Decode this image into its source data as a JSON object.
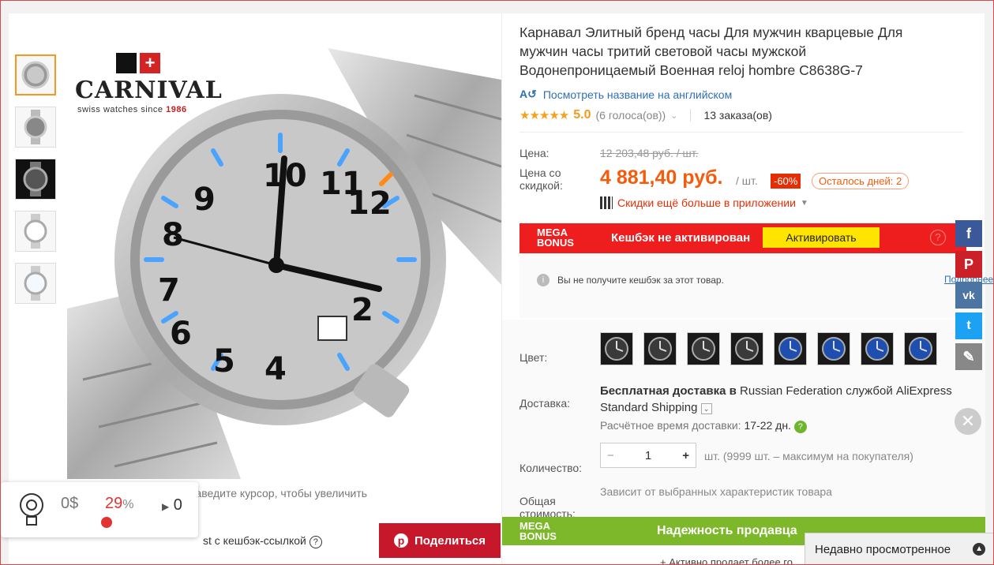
{
  "logo": {
    "brand": "CARNIVAL",
    "tagline": "swiss watches since",
    "year": "1986"
  },
  "gallery": {
    "hint": "Наведите курсор, чтобы увеличить"
  },
  "share": {
    "cashback_link": "st с кешбэк-ссылкой",
    "share_label": "Поделиться"
  },
  "widget": {
    "money": "0$",
    "percent": "29",
    "percent_sign": "%",
    "count": "0"
  },
  "product": {
    "title": "Карнавал Элитный бренд часы Для мужчин кварцевые Для мужчин часы тритий световой часы мужской Водонепроницаемый Военная reloj hombre C8638G-7",
    "translate_link": "Посмотреть название на английском",
    "rating": "5.0",
    "votes": "(6 голоса(ов))",
    "orders": "13 заказа(ов)"
  },
  "price": {
    "label": "Цена:",
    "old": "12 203,48 руб. / шт.",
    "discount_label": "Цена со скидкой:",
    "new": "4 881,40 руб.",
    "per": "/ шт.",
    "discount": "-60%",
    "days_left": "Осталось дней: 2",
    "app_deal": "Скидки ещё больше в приложении"
  },
  "mega_bonus": {
    "logo_line1": "MEGA",
    "logo_line2": "BONUS",
    "status": "Кешбэк не активирован",
    "activate": "Активировать",
    "info": "Вы не получите кешбэк за этот товар.",
    "more": "Подробнее"
  },
  "options": {
    "color_label": "Цвет:",
    "swatch_count": 8,
    "delivery_label": "Доставка:",
    "delivery_bold": "Бесплатная доставка в",
    "delivery_rest": " Russian Federation службой AliExpress Standard Shipping",
    "eta_label": "Расчётное время доставки:",
    "eta_value": "17-22 дн.",
    "qty_label": "Количество:",
    "qty_value": "1",
    "qty_info": "шт. (9999 шт. – максимум на покупателя)",
    "total_label": "Общая стоимость:",
    "total_value": "Зависит от выбранных характеристик товара"
  },
  "seller": {
    "logo_line1": "MEGA",
    "logo_line2": "BONUS",
    "title": "Надежность продавца",
    "note": "Активно продает более го"
  },
  "recent": {
    "label": "Недавно просмотренное"
  },
  "colors": {
    "accent": "#f55b0a",
    "mega_red": "#ef1e1e",
    "mega_green": "#7cb82a",
    "share": "#c7182b"
  }
}
